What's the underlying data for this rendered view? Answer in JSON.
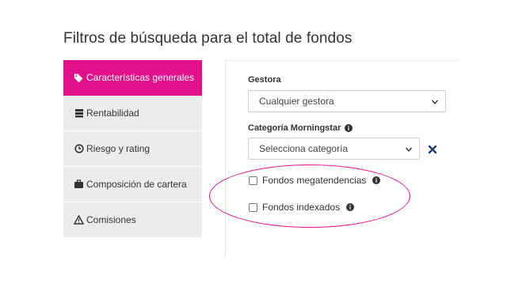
{
  "title": "Filtros de búsqueda para el total de fondos",
  "sidebar": {
    "items": [
      {
        "label": "Características generales",
        "icon": "tags-icon",
        "active": true
      },
      {
        "label": "Rentabilidad",
        "icon": "server-icon",
        "active": false
      },
      {
        "label": "Riesgo y rating",
        "icon": "clock-icon",
        "active": false
      },
      {
        "label": "Composición de cartera",
        "icon": "briefcase-icon",
        "active": false
      },
      {
        "label": "Comisiones",
        "icon": "warning-icon",
        "active": false
      }
    ]
  },
  "filters": {
    "gestora_label": "Gestora",
    "gestora_value": "Cualquier gestora",
    "categoria_label": "Categoría Morningstar",
    "categoria_value": "Selecciona categoría",
    "megatendencias_label": "Fondos megatendencias",
    "indexados_label": "Fondos indexados"
  },
  "colors": {
    "accent": "#e0118a",
    "sidebar_bg": "#ececec",
    "clear_icon": "#1e3a6e"
  }
}
